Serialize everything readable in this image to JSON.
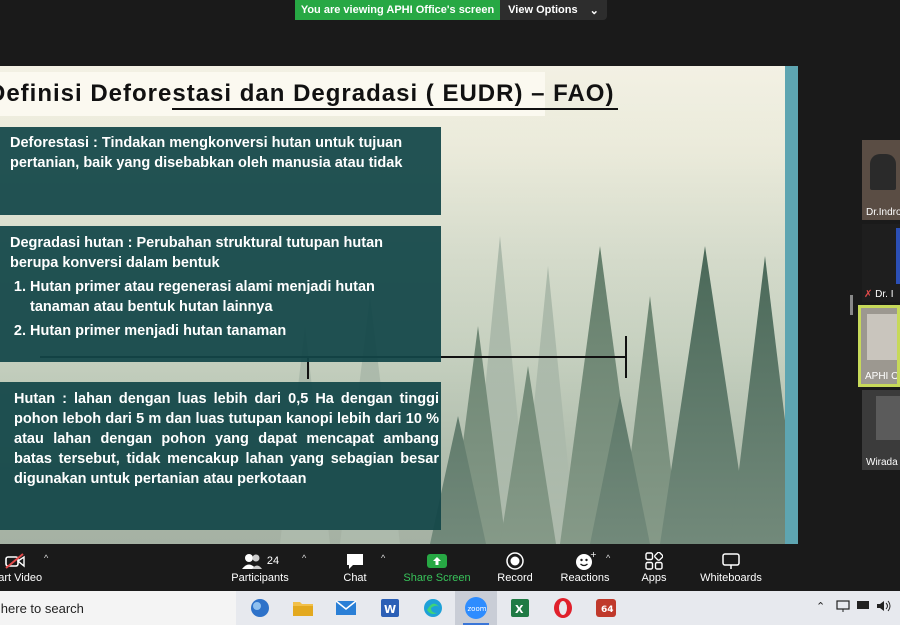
{
  "banner": {
    "viewing_text": "You are viewing APHI Office's screen",
    "view_options_label": "View Options"
  },
  "slide": {
    "title": "Definisi Deforestasi dan Degradasi ( EUDR) – FAO)",
    "box1_text": "Deforestasi : Tindakan mengkonversi hutan untuk tujuan pertanian, baik yang disebabkan oleh manusia atau tidak",
    "box2_intro": "Degradasi hutan : Perubahan struktural tutupan hutan berupa konversi dalam bentuk",
    "box2_items": [
      "Hutan primer atau regenerasi alami menjadi hutan tanaman atau bentuk hutan lainnya",
      "Hutan primer menjadi hutan tanaman"
    ],
    "box3_text": "Hutan : lahan dengan luas lebih dari 0,5 Ha dengan tinggi pohon leboh dari 5 m dan luas tutupan kanopi lebih dari 10 % atau lahan dengan pohon yang dapat mencapat ambang batas tersebut, tidak mencakup lahan yang sebagian besar digunakan untuk pertanian atau perkotaan"
  },
  "participants": [
    {
      "name": "Dr.Indro"
    },
    {
      "name": "Dr. I"
    },
    {
      "name": "APHI O"
    },
    {
      "name": "Wirada"
    }
  ],
  "toolbar": {
    "start_video": "Start Video",
    "participants_label": "Participants",
    "participants_count": "24",
    "chat": "Chat",
    "share_screen": "Share Screen",
    "record": "Record",
    "reactions": "Reactions",
    "apps": "Apps",
    "whiteboards": "Whiteboards"
  },
  "taskbar": {
    "search_placeholder": "Type here to search",
    "zoom_label": "zoom",
    "badge": "64"
  },
  "colors": {
    "share_green": "#27a844",
    "slide_box": "#124648",
    "slide_edge": "#5ea5b1",
    "active_border": "#c7d95a"
  }
}
